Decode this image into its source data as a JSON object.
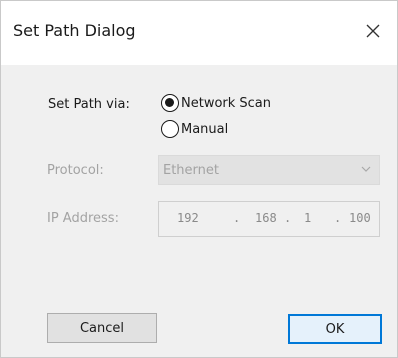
{
  "dialog": {
    "title": "Set Path Dialog"
  },
  "set_path": {
    "label": "Set Path via:",
    "options": [
      {
        "label": "Network Scan",
        "selected": true
      },
      {
        "label": "Manual",
        "selected": false
      }
    ]
  },
  "protocol": {
    "label": "Protocol:",
    "value": "Ethernet",
    "enabled": false
  },
  "ip_address": {
    "label": "IP Address:",
    "octets": [
      "192",
      "168",
      "1",
      "100"
    ],
    "separator": ".",
    "enabled": false
  },
  "buttons": {
    "cancel": "Cancel",
    "ok": "OK"
  },
  "icons": {
    "close": "close-icon",
    "dropdown": "chevron-down-icon"
  },
  "colors": {
    "default_button_border": "#0078d7",
    "disabled_text": "#a3a3a3"
  }
}
